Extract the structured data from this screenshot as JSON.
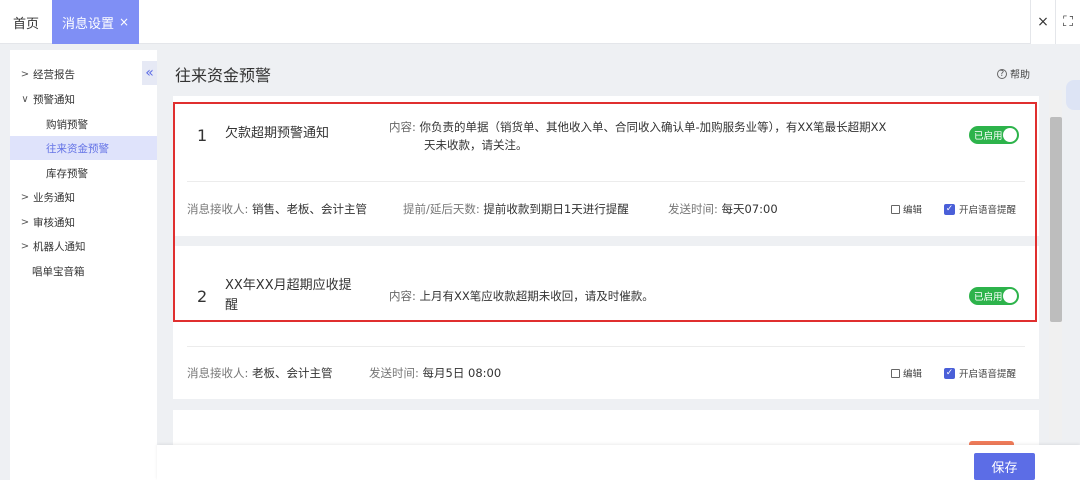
{
  "tabs": {
    "home": "首页",
    "active": "消息设置",
    "active_close": "×",
    "close_all": "×",
    "fullscreen": "⛶"
  },
  "sidebar": {
    "collapse": "«",
    "items": [
      {
        "label": "经营报告",
        "chevron": ">"
      },
      {
        "label": "预警通知",
        "chevron": "∨"
      },
      {
        "label": "购销预警"
      },
      {
        "label": "往来资金预警"
      },
      {
        "label": "库存预警"
      },
      {
        "label": "业务通知",
        "chevron": ">"
      },
      {
        "label": "审核通知",
        "chevron": ">"
      },
      {
        "label": "机器人通知",
        "chevron": ">"
      },
      {
        "label": "唱单宝音箱"
      }
    ]
  },
  "main": {
    "title": "往来资金预警",
    "help": "帮助",
    "help_icon": "?"
  },
  "cards": [
    {
      "index": "1",
      "name": "欠款超期预警通知",
      "content_label": "内容:",
      "content_line1": "你负责的单据（销货单、其他收入单、合同收入确认单-加购服务业等），有XX笔最长超期XX",
      "content_line2": "天未收款，请关注。",
      "toggle": "已启用",
      "receiver_label": "消息接收人:",
      "receiver": "销售、老板、会计主管",
      "days_label": "提前/延后天数:",
      "days": "提前收款到期日1天进行提醒",
      "send_label": "发送时间:",
      "send": "每天07:00",
      "edit": "编辑",
      "voice": "开启语音提醒"
    },
    {
      "index": "2",
      "name_line1": "XX年XX月超期应收提",
      "name_line2": "醒",
      "content_label": "内容:",
      "content_line1": "上月有XX笔应收款超期未收回，请及时催款。",
      "toggle": "已启用",
      "receiver_label": "消息接收人:",
      "receiver": "老板、会计主管",
      "send_label": "发送时间:",
      "send": "每月5日 08:00",
      "edit": "编辑",
      "voice": "开启语音提醒"
    }
  ],
  "footer": {
    "save": "保存"
  },
  "colors": {
    "accent": "#5c6de6",
    "tab_active": "#7f8ff5",
    "toggle_on": "#2db34b",
    "highlight_frame": "#e02f2f"
  }
}
